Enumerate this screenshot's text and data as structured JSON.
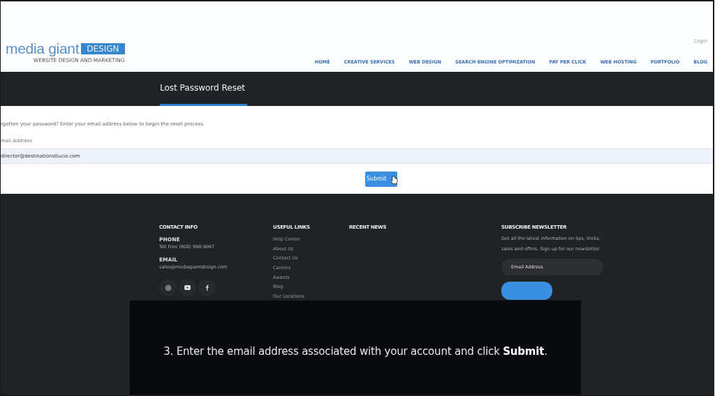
{
  "header": {
    "logo": {
      "name": "media giant",
      "badge": "DESIGN",
      "tagline": "WEBSITE DESIGN AND MARKETING"
    },
    "login": "Login",
    "nav": [
      {
        "label": "HOME"
      },
      {
        "label": "CREATIVE SERVICES"
      },
      {
        "label": "WEB DESIGN"
      },
      {
        "label": "SEARCH ENGINE OPTIMIZATION"
      },
      {
        "label": "PAY PER CLICK"
      },
      {
        "label": "WEB HOSTING"
      },
      {
        "label": "PORTFOLIO"
      },
      {
        "label": "BLOG"
      }
    ]
  },
  "title_bar": {
    "title": "Lost Password Reset"
  },
  "form": {
    "intro": "rgotten your password? Enter your email address below to begin the reset process.",
    "email_label": "mail Address",
    "email_value": "director@destinationstlucie.com",
    "submit": "Submit"
  },
  "footer": {
    "contact": {
      "heading": "CONTACT INFO",
      "phone_label": "PHONE",
      "phone": "Toll Free (800) 998-9067",
      "email_label": "EMAIL",
      "email": "sales@mediagiantdesign.com"
    },
    "links": {
      "heading": "USEFUL LINKS",
      "items": [
        "Help Center",
        "About Us",
        "Contact Us",
        "Careers",
        "Awards",
        "Blog",
        "Our Locations"
      ]
    },
    "recent_news": {
      "heading": "RECENT NEWS"
    },
    "newsletter": {
      "heading": "SUBSCRIBE NEWSLETTER",
      "text": "Get all the latest information on tips, tricks, sales and offers. Sign up for our newsletter.",
      "placeholder": "Email Address"
    }
  },
  "caption": "3. Enter the email address associated with your account and click **Submit**."
}
